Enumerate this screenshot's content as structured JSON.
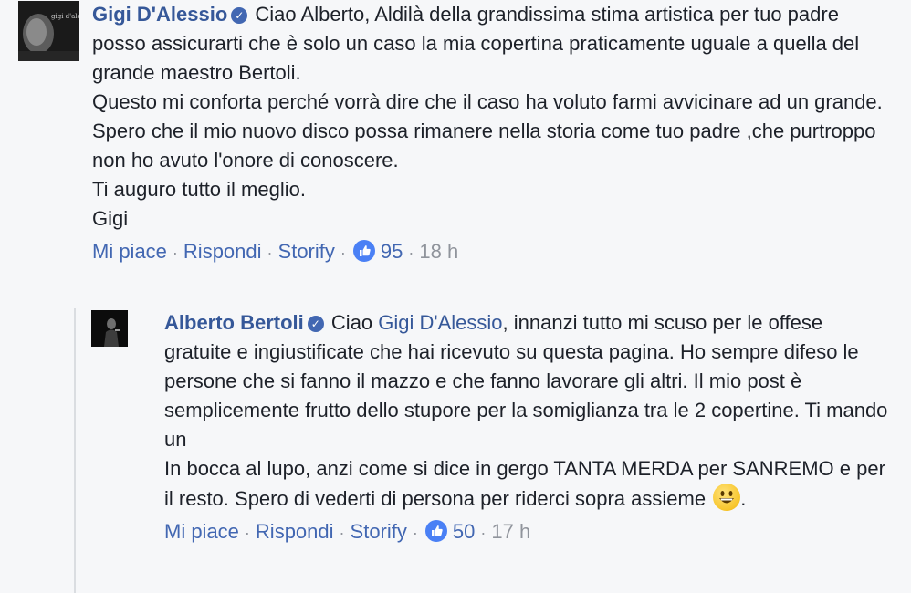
{
  "comments": [
    {
      "author": "Gigi D'Alessio",
      "avatar_text": "gigi d'alessio",
      "lines": [
        "Ciao Alberto, Aldilà della grandissima stima artistica per tuo padre posso assicurarti che è solo un caso la mia copertina praticamente uguale a quella del grande maestro Bertoli.",
        "Questo mi conforta perché vorrà dire che il caso ha voluto farmi avvicinare ad un grande.",
        "Spero che il mio nuovo disco possa rimanere nella storia come tuo padre ,che purtroppo non ho avuto l'onore di conoscere.",
        "Ti auguro tutto il meglio.",
        "Gigi"
      ],
      "actions": {
        "like": "Mi piace",
        "reply": "Rispondi",
        "storify": "Storify"
      },
      "likes": "95",
      "time": "18 h"
    },
    {
      "author": "Alberto Bertoli",
      "intro": "Ciao",
      "mention": "Gigi D'Alessio",
      "first_text": ", innanzi tutto mi scuso per le offese gratuite e ingiustificate che hai ricevuto su questa pagina. Ho sempre difeso le persone che si fanno il mazzo e che fanno lavorare gli altri. Il mio post è semplicemente frutto dello stupore per la somiglianza tra le 2 copertine. Ti mando un",
      "second_text": "In bocca al lupo, anzi come si dice in gergo TANTA MERDA per SANREMO e per il resto. Spero di vederti di persona per riderci sopra assieme",
      "end_text": ".",
      "actions": {
        "like": "Mi piace",
        "reply": "Rispondi",
        "storify": "Storify"
      },
      "likes": "50",
      "time": "17 h"
    }
  ],
  "separator": "·",
  "colors": {
    "link": "#365899",
    "meta": "#90949c",
    "like_badge": "#4a80f5",
    "background": "#f6f7f9"
  }
}
